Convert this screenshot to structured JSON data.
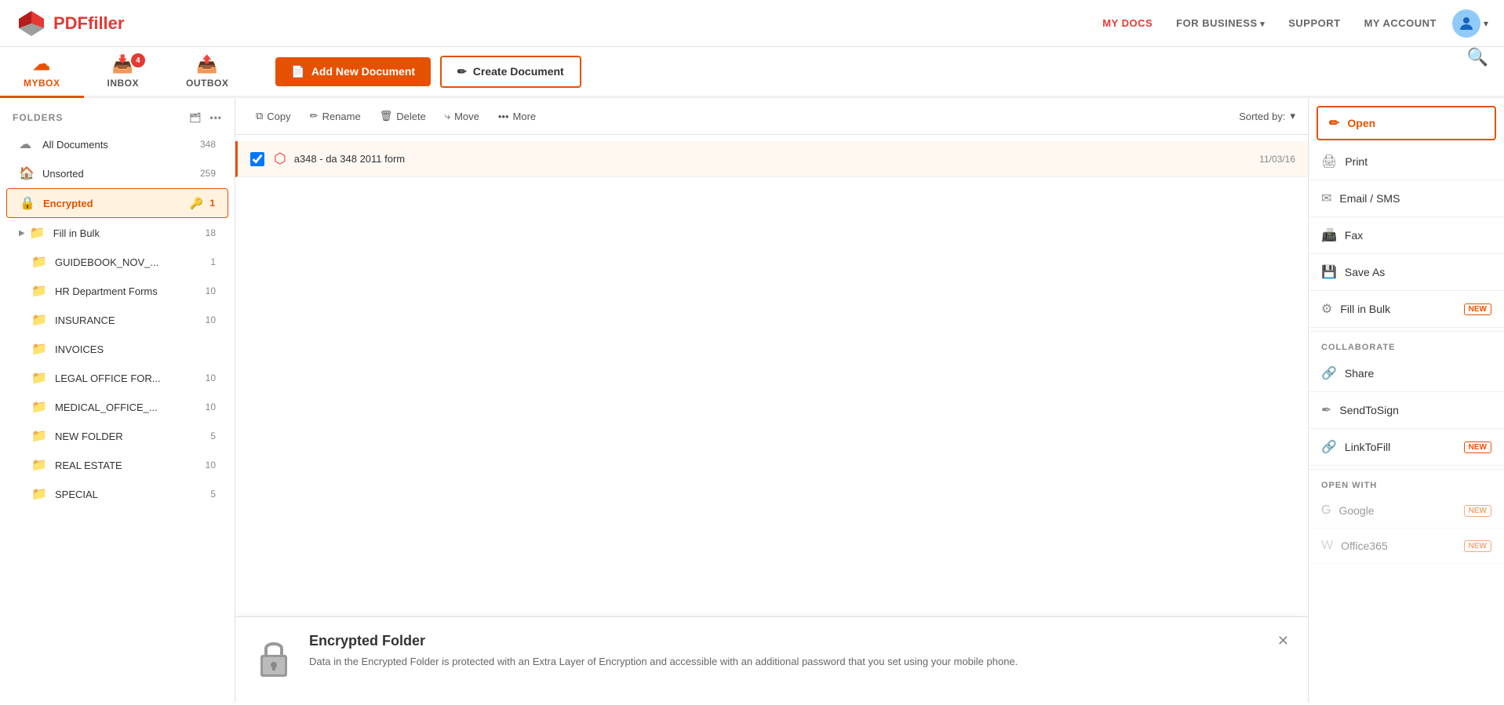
{
  "nav": {
    "logo_pdf": "PDF",
    "logo_filler": "filler",
    "links": [
      {
        "id": "my-docs",
        "label": "MY DOCS",
        "active": true
      },
      {
        "id": "for-business",
        "label": "FOR BUSINESS",
        "arrow": true
      },
      {
        "id": "support",
        "label": "SUPPORT"
      },
      {
        "id": "my-account",
        "label": "MY ACCOUNT"
      }
    ]
  },
  "tabs": [
    {
      "id": "mybox",
      "label": "MYBOX",
      "icon": "☁",
      "active": true,
      "badge": null
    },
    {
      "id": "inbox",
      "label": "INBOX",
      "icon": "📥",
      "active": false,
      "badge": "4"
    },
    {
      "id": "outbox",
      "label": "OUTBOX",
      "icon": "📤",
      "active": false,
      "badge": null
    }
  ],
  "toolbar_actions": {
    "add_label": "Add New Document",
    "create_label": "Create Document",
    "add_icon": "📄",
    "create_icon": "✏"
  },
  "doc_toolbar": {
    "copy": "Copy",
    "rename": "Rename",
    "delete": "Delete",
    "move": "Move",
    "more": "More",
    "sorted_by": "Sorted by:"
  },
  "folders": {
    "header": "FOLDERS",
    "items": [
      {
        "id": "all-documents",
        "label": "All Documents",
        "count": "348",
        "icon": "☁",
        "active": false
      },
      {
        "id": "unsorted",
        "label": "Unsorted",
        "count": "259",
        "icon": "🏠",
        "active": false
      },
      {
        "id": "encrypted",
        "label": "Encrypted",
        "count": "1",
        "icon": "🔒",
        "active": true,
        "special": true
      },
      {
        "id": "fill-in-bulk",
        "label": "Fill in Bulk",
        "count": "18",
        "icon": "📁",
        "expand": true,
        "active": false
      },
      {
        "id": "guidebook",
        "label": "GUIDEBOOK_NOV_...",
        "count": "1",
        "icon": "📁",
        "active": false
      },
      {
        "id": "hr-department",
        "label": "HR Department Forms",
        "count": "10",
        "icon": "📁",
        "active": false
      },
      {
        "id": "insurance",
        "label": "INSURANCE",
        "count": "10",
        "icon": "📁",
        "active": false
      },
      {
        "id": "invoices",
        "label": "INVOICES",
        "count": "",
        "icon": "📁",
        "active": false
      },
      {
        "id": "legal-office",
        "label": "LEGAL OFFICE FOR...",
        "count": "10",
        "icon": "📁",
        "active": false
      },
      {
        "id": "medical-office",
        "label": "MEDICAL_OFFICE_...",
        "count": "10",
        "icon": "📁",
        "active": false
      },
      {
        "id": "new-folder",
        "label": "NEW FOLDER",
        "count": "5",
        "icon": "📁",
        "active": false
      },
      {
        "id": "real-estate",
        "label": "REAL ESTATE",
        "count": "10",
        "icon": "📁",
        "active": false
      },
      {
        "id": "special",
        "label": "SPECIAL",
        "count": "5",
        "icon": "📁",
        "active": false
      }
    ]
  },
  "documents": [
    {
      "id": "doc1",
      "name": "a348 - da 348 2011 form",
      "date": "11/03/16",
      "selected": true
    }
  ],
  "encrypted_notice": {
    "title": "Encrypted Folder",
    "description": "Data in the Encrypted Folder is protected with an Extra Layer of Encryption and accessible with an additional password that you set using your mobile phone."
  },
  "right_panel": {
    "open_label": "Open",
    "print_label": "Print",
    "email_sms_label": "Email / SMS",
    "fax_label": "Fax",
    "save_as_label": "Save As",
    "fill_in_bulk_label": "Fill in Bulk",
    "collaborate_header": "COLLABORATE",
    "share_label": "Share",
    "send_to_sign_label": "SendToSign",
    "link_to_fill_label": "LinkToFill",
    "open_with_header": "OPEN WITH",
    "google_label": "Google",
    "office365_label": "Office365"
  }
}
